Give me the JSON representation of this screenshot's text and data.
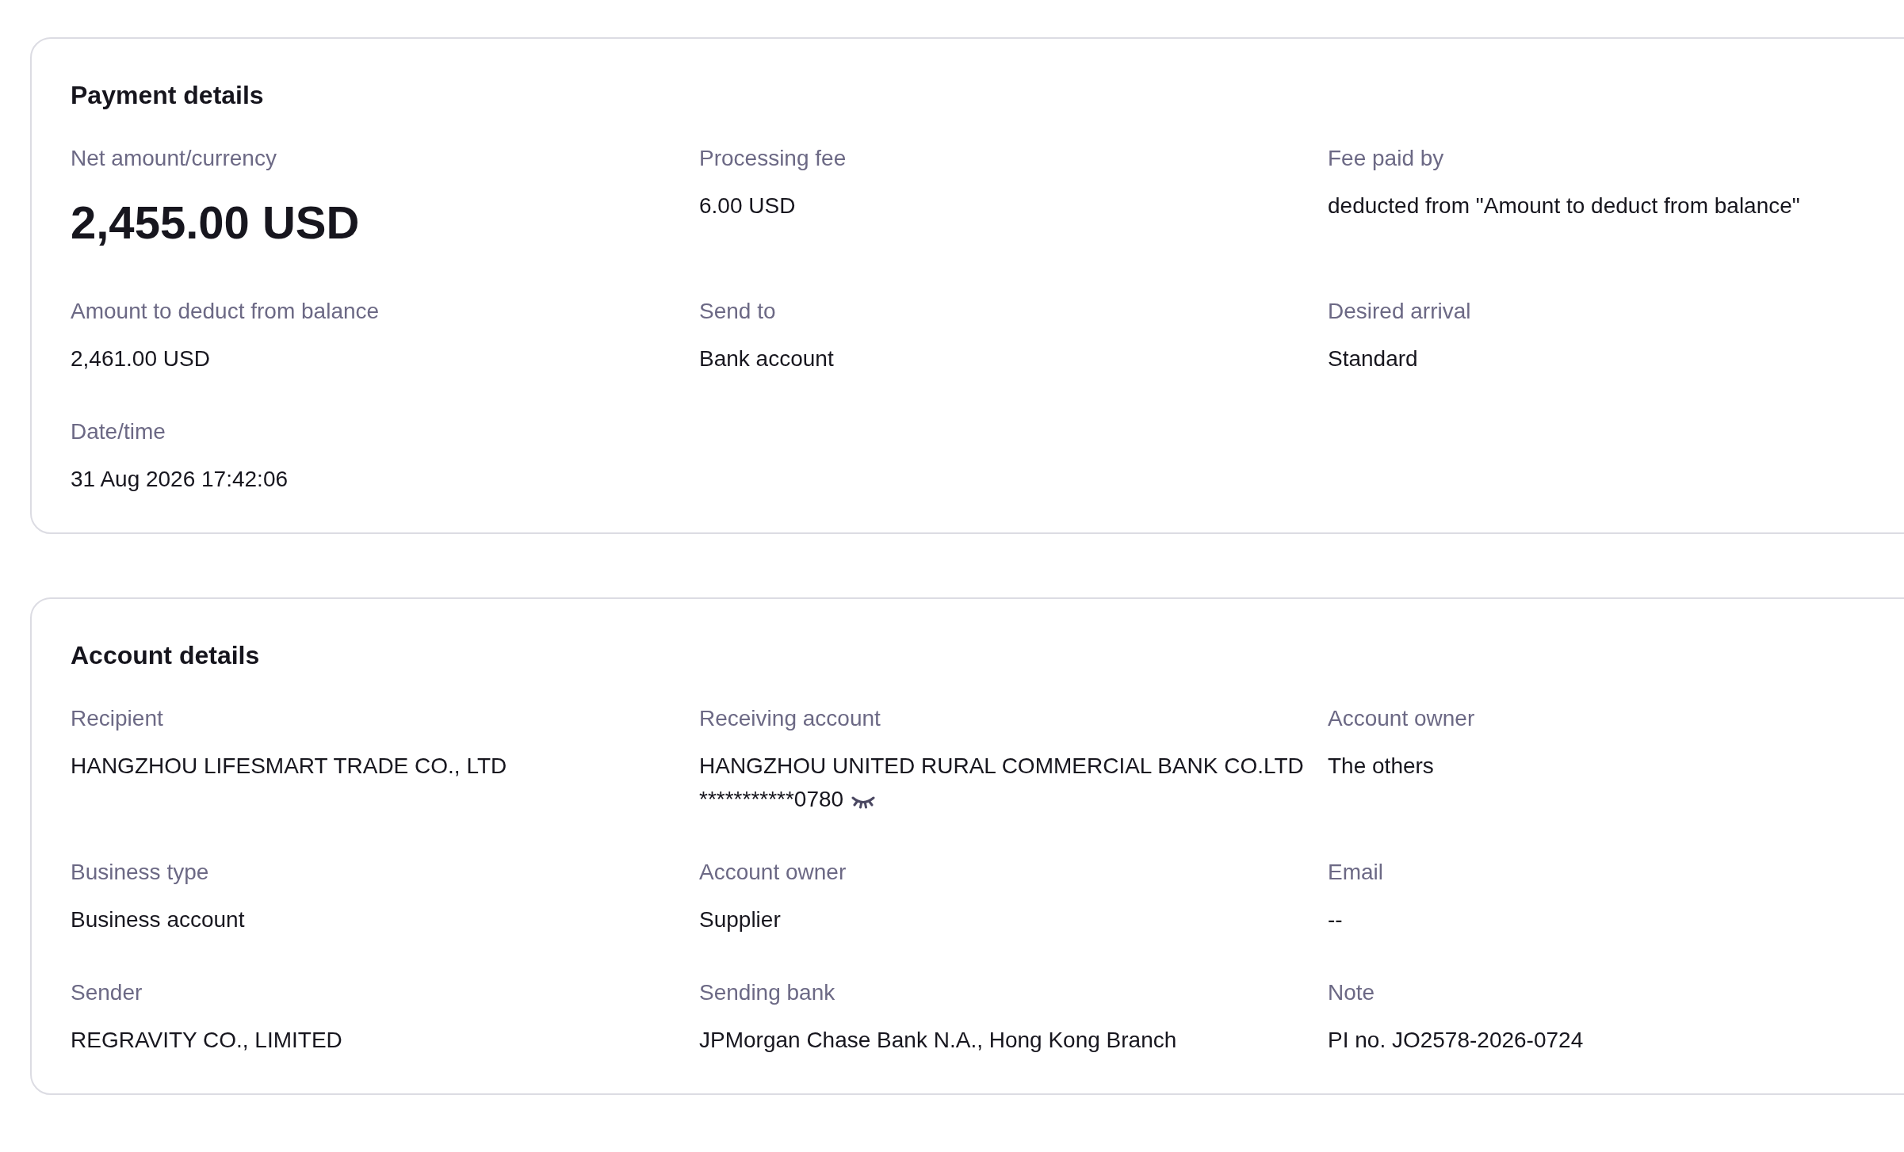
{
  "sections": [
    {
      "title": "Payment details",
      "fields": [
        {
          "kind": "amount",
          "label": "Net amount/currency",
          "value": "2,455.00 USD"
        },
        {
          "kind": "text",
          "label": "Processing fee",
          "value": "6.00 USD"
        },
        {
          "kind": "text",
          "label": "Fee paid by",
          "value": "deducted from \"Amount to deduct from balance\""
        },
        {
          "kind": "text",
          "label": "Amount to deduct from balance",
          "value": "2,461.00 USD"
        },
        {
          "kind": "text",
          "label": "Send to",
          "value": "Bank account"
        },
        {
          "kind": "text",
          "label": "Desired arrival",
          "value": "Standard"
        },
        {
          "kind": "text",
          "label": "Date/time",
          "value": "31 Aug 2026 17:42:06"
        }
      ]
    },
    {
      "title": "Account details",
      "fields": [
        {
          "kind": "text",
          "label": "Recipient",
          "value": "HANGZHOU LIFESMART TRADE CO., LTD"
        },
        {
          "kind": "account",
          "label": "Receiving account",
          "value": "HANGZHOU UNITED RURAL COMMERCIAL BANK CO.LTD",
          "number": "***********0780",
          "masked": true
        },
        {
          "kind": "text",
          "label": "Account owner",
          "value": "The others"
        },
        {
          "kind": "text",
          "label": "Business type",
          "value": "Business account"
        },
        {
          "kind": "text",
          "label": "Account owner",
          "value": "Supplier"
        },
        {
          "kind": "text",
          "label": "Email",
          "value": "--"
        },
        {
          "kind": "text",
          "label": "Sender",
          "value": "REGRAVITY CO., LIMITED"
        },
        {
          "kind": "text",
          "label": "Sending bank",
          "value": "JPMorgan Chase Bank N.A., Hong Kong Branch"
        },
        {
          "kind": "text",
          "label": "Note",
          "value": "PI no. JO2578-2026-0724"
        }
      ]
    }
  ]
}
